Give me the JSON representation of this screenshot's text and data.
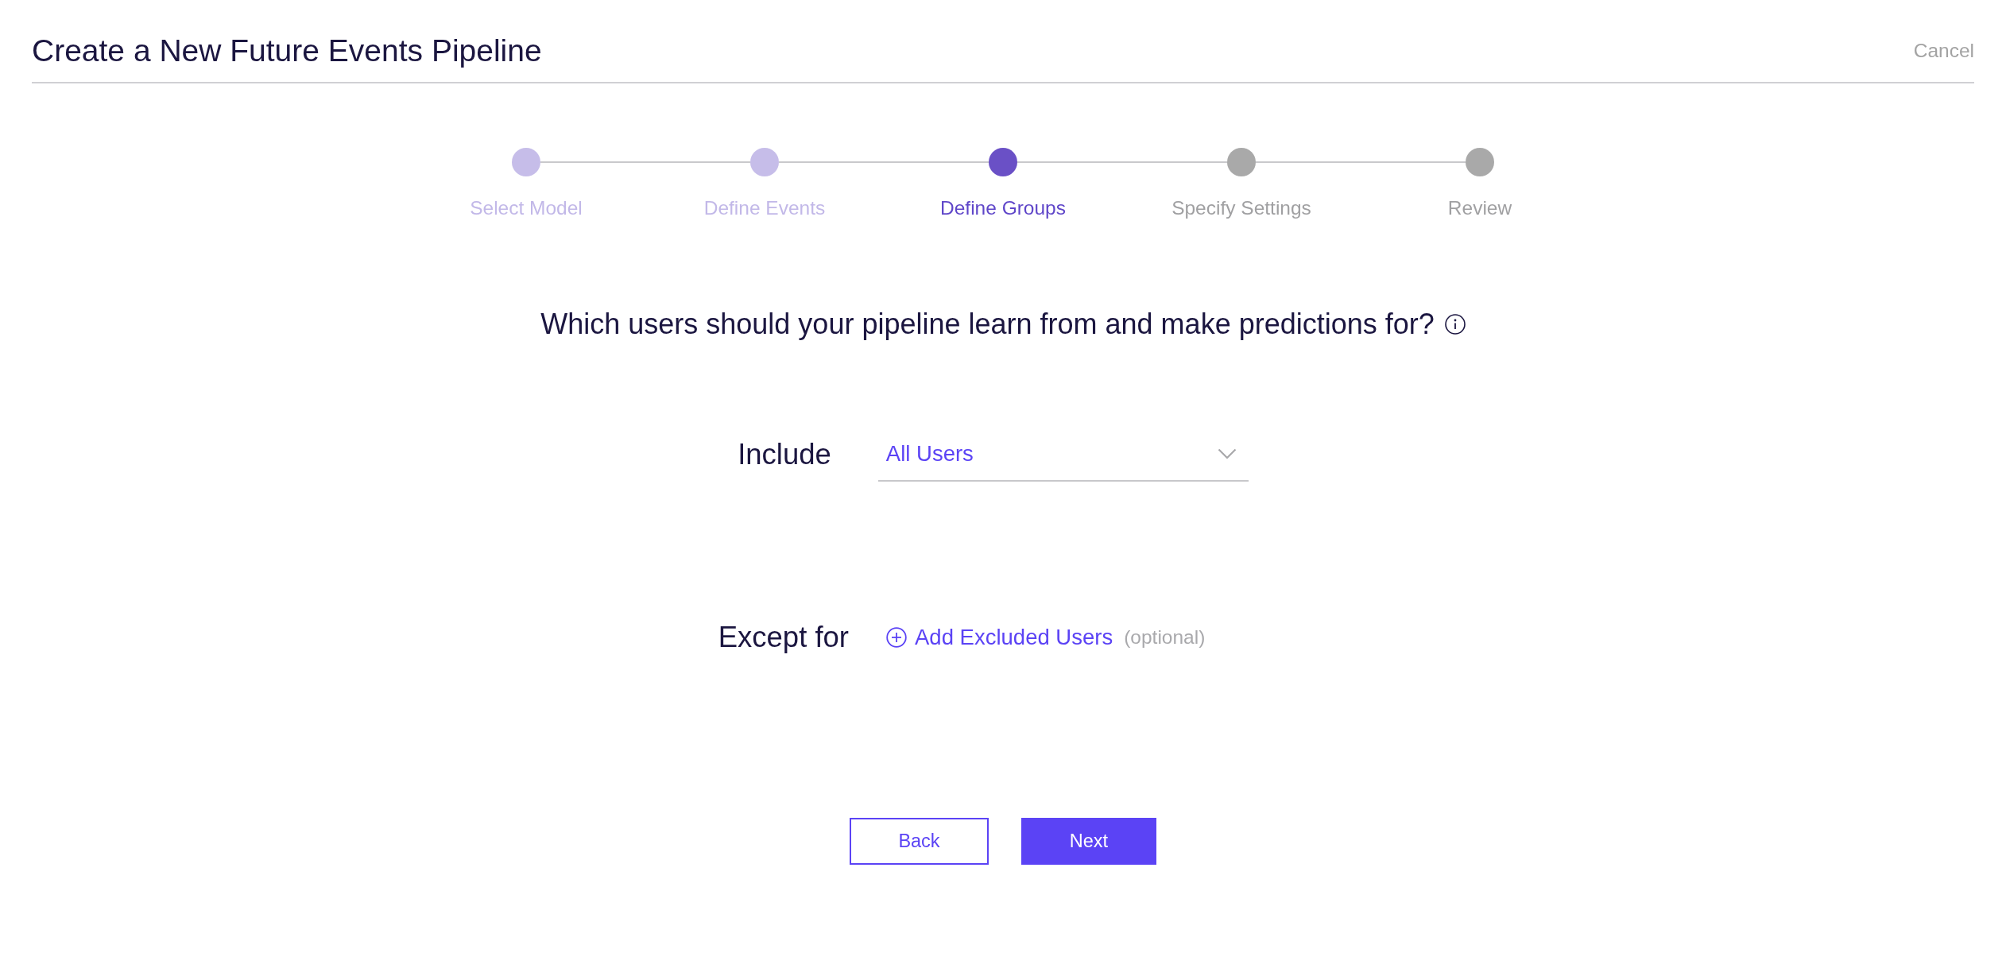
{
  "header": {
    "title": "Create a New Future Events Pipeline",
    "cancel": "Cancel"
  },
  "steps": [
    {
      "label": "Select Model",
      "selected": false,
      "completed": true
    },
    {
      "label": "Define Events",
      "selected": false,
      "completed": true
    },
    {
      "label": "Define Groups",
      "selected": true,
      "completed": false
    },
    {
      "label": "Specify Settings",
      "selected": false,
      "completed": false
    },
    {
      "label": "Review",
      "selected": false,
      "completed": false
    }
  ],
  "question": "Which users should your pipeline learn from and make predictions for?",
  "include": {
    "label": "Include",
    "value": "All Users"
  },
  "exclude": {
    "label": "Except for",
    "action": "Add Excluded Users",
    "hint": "(optional)"
  },
  "buttons": [
    {
      "label": "Back",
      "kind": "secondary"
    },
    {
      "label": "Next",
      "kind": "primary"
    }
  ]
}
